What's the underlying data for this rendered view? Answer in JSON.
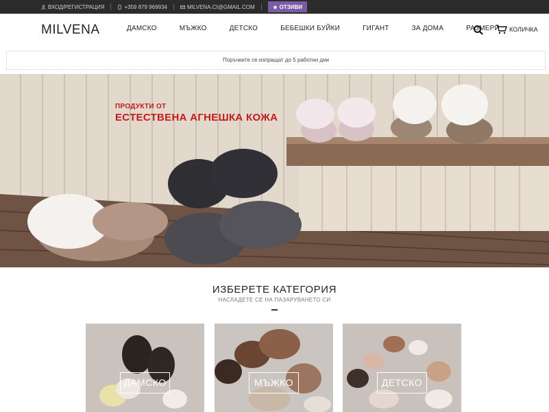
{
  "topbar": {
    "login": "ВХОД/РЕГИСТРАЦИЯ",
    "phone": "+359 879 969934",
    "email": "MILVENA.CI@GMAIL.COM",
    "reviews": "ОТЗИВИ"
  },
  "header": {
    "logo": "MILVENA",
    "nav": [
      "ДАМСКО",
      "МЪЖКО",
      "ДЕТСКО",
      "БЕБЕШКИ БУЙКИ",
      "ГИГАНТ",
      "ЗА ДОМА",
      "РАЗМЕРИ"
    ],
    "cart_label": "КОЛИЧКА"
  },
  "notice": "Поръчките се изпращат до 5 работни дни",
  "hero": {
    "subtitle": "ПРОДУКТИ ОТ",
    "title": "ЕСТЕСТВЕНА АГНЕШКА КОЖА"
  },
  "categories": {
    "title": "ИЗБЕРЕТЕ КАТЕГОРИЯ",
    "subtitle": "НАСЛАДЕТЕ СЕ НА ПАЗАРУВАНЕТО СИ",
    "items": [
      {
        "label": "ДАМСКО"
      },
      {
        "label": "МЪЖКО"
      },
      {
        "label": "ДЕТСКО"
      }
    ]
  },
  "colors": {
    "topbar_bg": "#2b2b2b",
    "accent_purple": "#7b5aa6",
    "hero_red": "#c41a1a"
  },
  "icons": [
    "user-icon",
    "phone-icon",
    "mail-icon",
    "star-icon",
    "search-icon",
    "cart-icon"
  ]
}
